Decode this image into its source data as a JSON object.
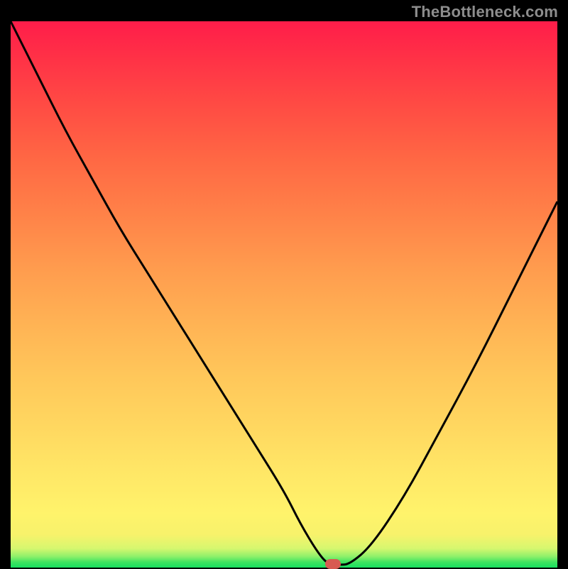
{
  "watermark": "TheBottleneck.com",
  "chart_data": {
    "type": "line",
    "title": "",
    "xlabel": "",
    "ylabel": "",
    "xlim": [
      0,
      100
    ],
    "ylim": [
      0,
      100
    ],
    "background_gradient": {
      "top": "#ff1d4a",
      "middle": "#ffd760",
      "bottom": "#18e060"
    },
    "series": [
      {
        "name": "bottleneck-curve",
        "x": [
          0,
          5,
          10,
          15,
          20,
          25,
          30,
          35,
          40,
          45,
          50,
          53,
          56,
          58,
          60,
          62,
          66,
          72,
          78,
          85,
          92,
          100
        ],
        "values": [
          100,
          90,
          80,
          71,
          62,
          54,
          46,
          38,
          30,
          22,
          14,
          8,
          3,
          0.6,
          0.5,
          0.6,
          4,
          13,
          24,
          37,
          51,
          67
        ]
      }
    ],
    "marker": {
      "x": 59,
      "y": 0.6
    }
  }
}
